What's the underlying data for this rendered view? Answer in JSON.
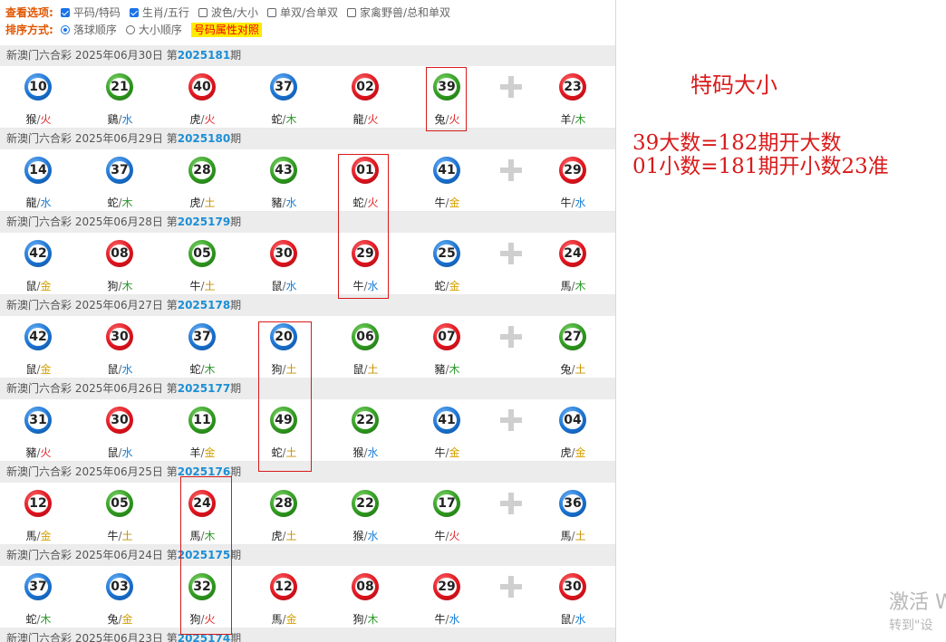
{
  "options": {
    "view_label": "查看选项:",
    "view_items": [
      {
        "label": "平码/特码",
        "checked": true
      },
      {
        "label": "生肖/五行",
        "checked": true
      },
      {
        "label": "波色/大小",
        "checked": false
      },
      {
        "label": "单双/合单双",
        "checked": false
      },
      {
        "label": "家禽野兽/总和单双",
        "checked": false
      }
    ],
    "sort_label": "排序方式:",
    "sort_items": [
      {
        "label": "落球顺序",
        "checked": true
      },
      {
        "label": "大小顺序",
        "checked": false
      }
    ],
    "attr_button": "号码属性对照"
  },
  "draws": [
    {
      "prefix": "新澳门六合彩 2025年06月30日 第",
      "issue": "2025181",
      "suffix": "期",
      "balls": [
        {
          "num": "10",
          "color": "blue",
          "animal": "猴",
          "element": "火"
        },
        {
          "num": "21",
          "color": "green",
          "animal": "鷄",
          "element": "水"
        },
        {
          "num": "40",
          "color": "red",
          "animal": "虎",
          "element": "火"
        },
        {
          "num": "37",
          "color": "blue",
          "animal": "蛇",
          "element": "木"
        },
        {
          "num": "02",
          "color": "red",
          "animal": "龍",
          "element": "火"
        },
        {
          "num": "39",
          "color": "green",
          "animal": "兔",
          "element": "火"
        },
        {
          "num": "23",
          "color": "red",
          "animal": "羊",
          "element": "木"
        }
      ]
    },
    {
      "prefix": "新澳门六合彩 2025年06月29日 第",
      "issue": "2025180",
      "suffix": "期",
      "balls": [
        {
          "num": "14",
          "color": "blue",
          "animal": "龍",
          "element": "水"
        },
        {
          "num": "37",
          "color": "blue",
          "animal": "蛇",
          "element": "木"
        },
        {
          "num": "28",
          "color": "green",
          "animal": "虎",
          "element": "土"
        },
        {
          "num": "43",
          "color": "green",
          "animal": "豬",
          "element": "水"
        },
        {
          "num": "01",
          "color": "red",
          "animal": "蛇",
          "element": "火"
        },
        {
          "num": "41",
          "color": "blue",
          "animal": "牛",
          "element": "金"
        },
        {
          "num": "29",
          "color": "red",
          "animal": "牛",
          "element": "水"
        }
      ]
    },
    {
      "prefix": "新澳门六合彩 2025年06月28日 第",
      "issue": "2025179",
      "suffix": "期",
      "balls": [
        {
          "num": "42",
          "color": "blue",
          "animal": "鼠",
          "element": "金"
        },
        {
          "num": "08",
          "color": "red",
          "animal": "狗",
          "element": "木"
        },
        {
          "num": "05",
          "color": "green",
          "animal": "牛",
          "element": "土"
        },
        {
          "num": "30",
          "color": "red",
          "animal": "鼠",
          "element": "水"
        },
        {
          "num": "29",
          "color": "red",
          "animal": "牛",
          "element": "水"
        },
        {
          "num": "25",
          "color": "blue",
          "animal": "蛇",
          "element": "金"
        },
        {
          "num": "24",
          "color": "red",
          "animal": "馬",
          "element": "木"
        }
      ]
    },
    {
      "prefix": "新澳门六合彩 2025年06月27日 第",
      "issue": "2025178",
      "suffix": "期",
      "balls": [
        {
          "num": "42",
          "color": "blue",
          "animal": "鼠",
          "element": "金"
        },
        {
          "num": "30",
          "color": "red",
          "animal": "鼠",
          "element": "水"
        },
        {
          "num": "37",
          "color": "blue",
          "animal": "蛇",
          "element": "木"
        },
        {
          "num": "20",
          "color": "blue",
          "animal": "狗",
          "element": "土"
        },
        {
          "num": "06",
          "color": "green",
          "animal": "鼠",
          "element": "土"
        },
        {
          "num": "07",
          "color": "red",
          "animal": "豬",
          "element": "木"
        },
        {
          "num": "27",
          "color": "green",
          "animal": "兔",
          "element": "土"
        }
      ]
    },
    {
      "prefix": "新澳门六合彩 2025年06月26日 第",
      "issue": "2025177",
      "suffix": "期",
      "balls": [
        {
          "num": "31",
          "color": "blue",
          "animal": "豬",
          "element": "火"
        },
        {
          "num": "30",
          "color": "red",
          "animal": "鼠",
          "element": "水"
        },
        {
          "num": "11",
          "color": "green",
          "animal": "羊",
          "element": "金"
        },
        {
          "num": "49",
          "color": "green",
          "animal": "蛇",
          "element": "土"
        },
        {
          "num": "22",
          "color": "green",
          "animal": "猴",
          "element": "水"
        },
        {
          "num": "41",
          "color": "blue",
          "animal": "牛",
          "element": "金"
        },
        {
          "num": "04",
          "color": "blue",
          "animal": "虎",
          "element": "金"
        }
      ]
    },
    {
      "prefix": "新澳门六合彩 2025年06月25日 第",
      "issue": "2025176",
      "suffix": "期",
      "balls": [
        {
          "num": "12",
          "color": "red",
          "animal": "馬",
          "element": "金"
        },
        {
          "num": "05",
          "color": "green",
          "animal": "牛",
          "element": "土"
        },
        {
          "num": "24",
          "color": "red",
          "animal": "馬",
          "element": "木"
        },
        {
          "num": "28",
          "color": "green",
          "animal": "虎",
          "element": "土"
        },
        {
          "num": "22",
          "color": "green",
          "animal": "猴",
          "element": "水"
        },
        {
          "num": "17",
          "color": "green",
          "animal": "牛",
          "element": "火"
        },
        {
          "num": "36",
          "color": "blue",
          "animal": "馬",
          "element": "土"
        }
      ]
    },
    {
      "prefix": "新澳门六合彩 2025年06月24日 第",
      "issue": "2025175",
      "suffix": "期",
      "balls": [
        {
          "num": "37",
          "color": "blue",
          "animal": "蛇",
          "element": "木"
        },
        {
          "num": "03",
          "color": "blue",
          "animal": "兔",
          "element": "金"
        },
        {
          "num": "32",
          "color": "green",
          "animal": "狗",
          "element": "火"
        },
        {
          "num": "12",
          "color": "red",
          "animal": "馬",
          "element": "金"
        },
        {
          "num": "08",
          "color": "red",
          "animal": "狗",
          "element": "木"
        },
        {
          "num": "29",
          "color": "red",
          "animal": "牛",
          "element": "水"
        },
        {
          "num": "30",
          "color": "red",
          "animal": "鼠",
          "element": "水"
        }
      ]
    },
    {
      "prefix": "新澳门六合彩 2025年06月23日 第",
      "issue": "2025174",
      "suffix": "期",
      "balls": []
    }
  ],
  "annotation": {
    "title": "特码大小",
    "line1": "39大数=182期开大数",
    "line2": "01小数=181期开小数23准"
  },
  "watermark": {
    "line1": "激活 W",
    "line2": "转到\"设"
  },
  "colors": {
    "red_ball": "#e0141e",
    "blue_ball": "#1a72d0",
    "green_ball": "#2f9a1f",
    "annotation_red": "#d91a1a",
    "issue_blue": "#1b8fd6"
  }
}
